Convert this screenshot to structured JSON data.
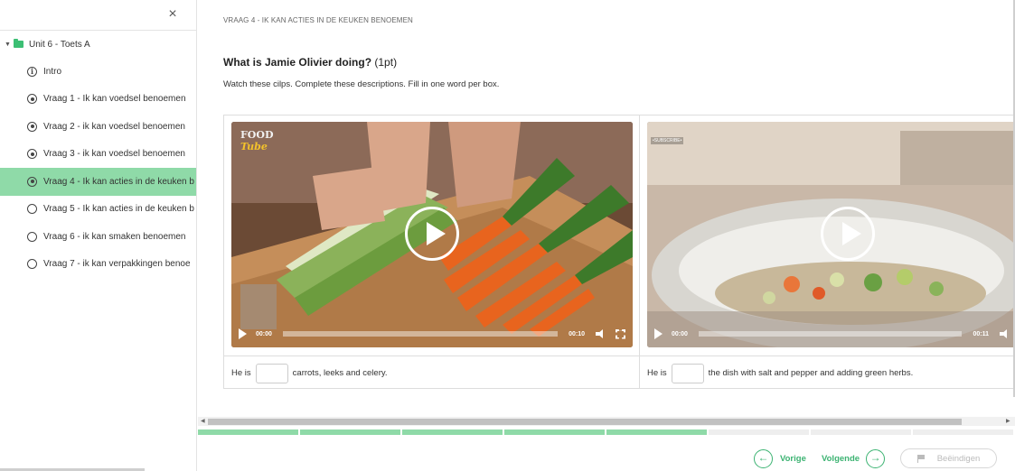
{
  "sidebar": {
    "close_icon": "×",
    "unit_label": "Unit 6 - Toets A",
    "items": [
      {
        "label": "Intro",
        "icon": "info-icon",
        "state": "info"
      },
      {
        "label": "Vraag 1 - Ik kan voedsel benoemen",
        "icon": "radio-dot-icon",
        "state": "visited"
      },
      {
        "label": "Vraag 2 - ik kan voedsel benoemen",
        "icon": "radio-dot-icon",
        "state": "visited"
      },
      {
        "label": "Vraag 3 - ik kan voedsel benoemen",
        "icon": "radio-dot-icon",
        "state": "visited"
      },
      {
        "label": "Vraag 4 - Ik kan acties in de keuken b",
        "icon": "radio-dot-icon",
        "state": "active"
      },
      {
        "label": "Vraag 5 - Ik kan acties in de keuken b",
        "icon": "radio-empty-icon",
        "state": "open"
      },
      {
        "label": "Vraag 6 - ik kan smaken benoemen",
        "icon": "radio-empty-icon",
        "state": "open"
      },
      {
        "label": "Vraag 7 - ik kan verpakkingen benoe",
        "icon": "radio-empty-icon",
        "state": "open"
      }
    ]
  },
  "main": {
    "breadcrumb": "VRAAG 4 - IK KAN ACTIES IN DE KEUKEN BENOEMEN",
    "question_title": "What is Jamie Olivier doing?",
    "question_points": "(1pt)",
    "instructions": "Watch these cilps. Complete these descriptions. Fill in one word per box.",
    "videos": [
      {
        "logo_line1": "FOOD",
        "logo_line2": "Tube",
        "time_current": "00:00",
        "time_total": "00:10",
        "sentence_before": "He is",
        "sentence_after": "carrots, leeks and celery.",
        "input_value": ""
      },
      {
        "badge": "•SUBSCRIBE•",
        "time_current": "00:00",
        "time_total": "00:11",
        "sentence_before": "He is",
        "sentence_after": "the dish with salt and pepper and adding green herbs.",
        "input_value": ""
      }
    ],
    "progress": {
      "total_segments": 8,
      "completed_segments": 5
    },
    "nav": {
      "prev_label": "Vorige",
      "next_label": "Volgende",
      "finish_label": "Beëindigen",
      "prev_icon": "arrow-left-icon",
      "next_icon": "arrow-right-icon",
      "finish_icon": "flag-icon"
    }
  },
  "colors": {
    "accent": "#3cb372",
    "active_bg": "#8fdaa8",
    "folder": "#3cbf74"
  }
}
